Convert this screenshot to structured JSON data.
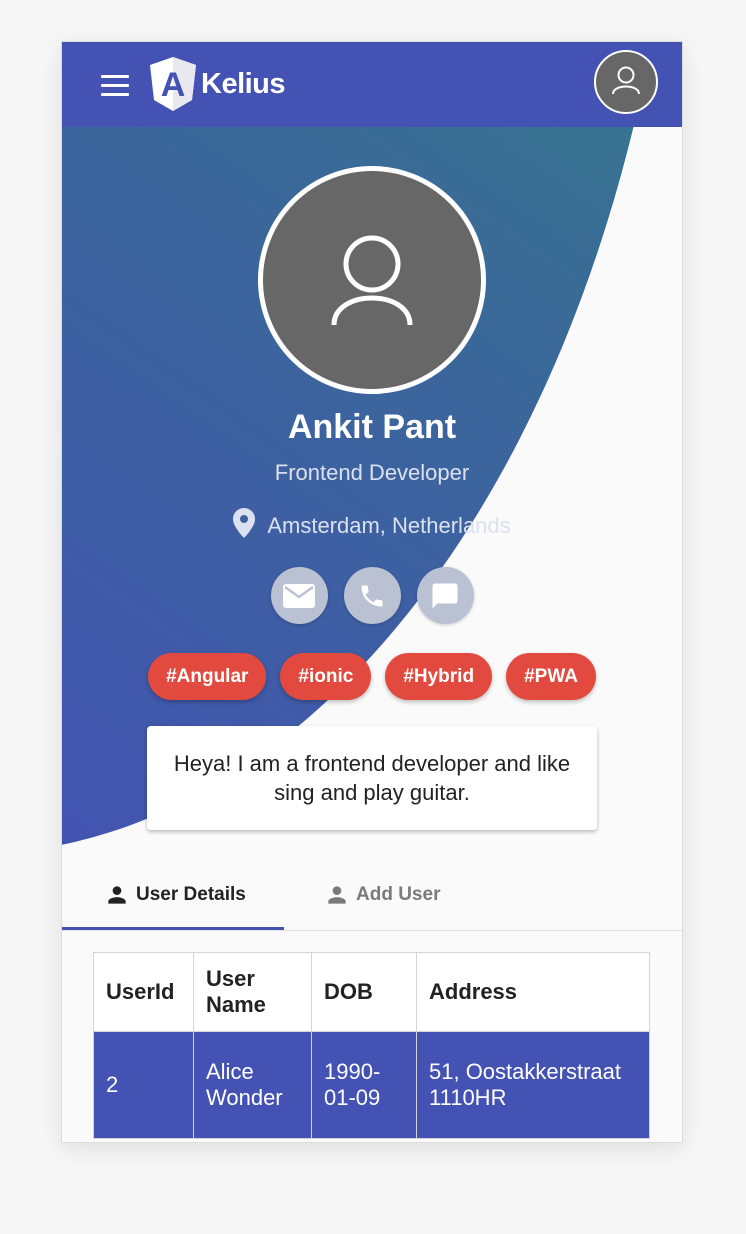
{
  "header": {
    "brand": "Kelius",
    "logo_letter": "A",
    "menu_icon": "hamburger-icon",
    "avatar_icon": "user-icon"
  },
  "profile": {
    "name": "Ankit Pant",
    "role": "Frontend Developer",
    "location": "Amsterdam, Netherlands",
    "location_icon": "location-pin-icon",
    "contact_icons": [
      "mail-icon",
      "phone-icon",
      "chat-icon"
    ],
    "tags": [
      "#Angular",
      "#ionic",
      "#Hybrid",
      "#PWA"
    ],
    "bio": "Heya! I am a frontend developer and like sing and play guitar."
  },
  "tabs": [
    {
      "label": "User Details",
      "icon": "person-icon",
      "active": true
    },
    {
      "label": "Add User",
      "icon": "person-icon",
      "active": false
    }
  ],
  "table": {
    "headers": [
      "UserId",
      "User Name",
      "DOB",
      "Address"
    ],
    "rows": [
      [
        "2",
        "Alice Wonder",
        "1990-01-09",
        "51, Oostakkerstraat 1110HR"
      ]
    ]
  },
  "colors": {
    "primary": "#4352b3",
    "gradient_end": "#358385",
    "tag": "#e34a3f",
    "avatar": "#676767",
    "contact_button": "#b9c1d3"
  }
}
